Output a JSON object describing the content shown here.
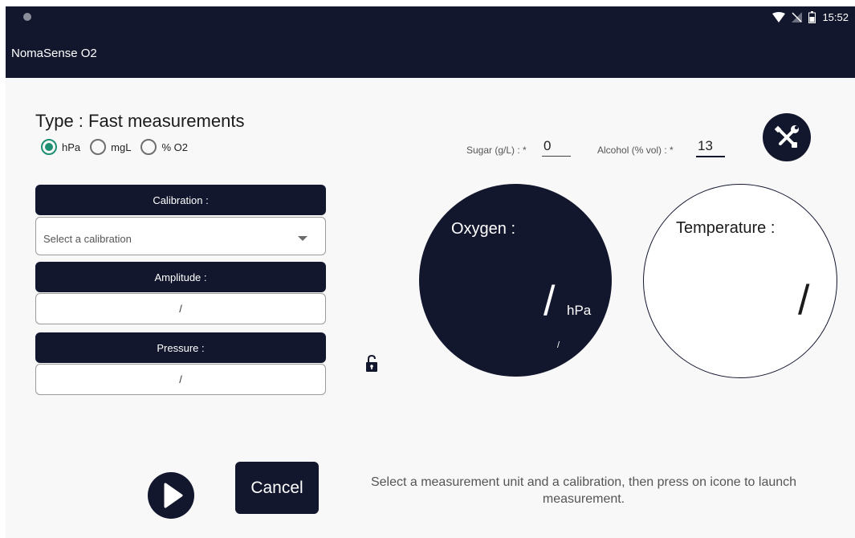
{
  "status_bar": {
    "time": "15:52",
    "icons": [
      "wifi-icon",
      "no-signal-icon",
      "battery-icon"
    ]
  },
  "app": {
    "title": "NomaSense O2"
  },
  "type": {
    "label": "Type :",
    "value": "Fast measurements"
  },
  "units": {
    "options": [
      {
        "label": "hPa",
        "checked": true
      },
      {
        "label": "mgL",
        "checked": false
      },
      {
        "label": "% O2",
        "checked": false
      }
    ]
  },
  "sugar": {
    "label": "Sugar (g/L) : *",
    "value": "0"
  },
  "alcohol": {
    "label": "Alcohol (% vol) : *",
    "value": "13"
  },
  "calibration": {
    "header": "Calibration :",
    "placeholder": "Select a calibration"
  },
  "amplitude": {
    "header": "Amplitude :",
    "value": "/"
  },
  "pressure": {
    "header": "Pressure :",
    "value": "/"
  },
  "oxygen": {
    "label": "Oxygen :",
    "value": "/",
    "unit": "hPa",
    "sub_value": "/"
  },
  "temperature": {
    "label": "Temperature :",
    "value": "/"
  },
  "actions": {
    "cancel_label": "Cancel"
  },
  "instruction": "Select a measurement unit and a calibration, then press  on icone to launch measurement.",
  "colors": {
    "primary": "#13172e",
    "radio_checked": "#1d8f72",
    "background": "#f8f8f8"
  }
}
